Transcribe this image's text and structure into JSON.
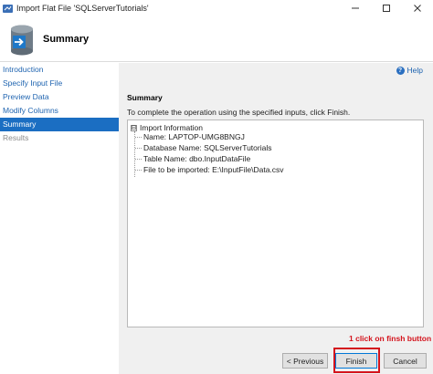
{
  "window": {
    "title": "Import Flat File 'SQLServerTutorials'",
    "controls": [
      "minimize-icon",
      "maximize-icon",
      "close-icon"
    ]
  },
  "header": {
    "title": "Summary",
    "icon": "database-import-icon"
  },
  "nav": {
    "items": [
      {
        "label": "Introduction",
        "state": "link"
      },
      {
        "label": "Specify Input File",
        "state": "link"
      },
      {
        "label": "Preview Data",
        "state": "link"
      },
      {
        "label": "Modify Columns",
        "state": "link"
      },
      {
        "label": "Summary",
        "state": "active"
      },
      {
        "label": "Results",
        "state": "disabled"
      }
    ]
  },
  "content": {
    "help_label": "Help",
    "section_title": "Summary",
    "instruction": "To complete the operation using the specified inputs, click Finish.",
    "tree": {
      "root_label": "Import Information",
      "expander": "⊟",
      "children": [
        "Name: LAPTOP-UMG8BNGJ",
        "Database Name: SQLServerTutorials",
        "Table Name: dbo.InputDataFile",
        "File to be imported: E:\\InputFile\\Data.csv"
      ]
    },
    "annotation": "1 click on finsh button"
  },
  "footer": {
    "previous_label": "< Previous",
    "finish_label": "Finish",
    "cancel_label": "Cancel"
  },
  "colors": {
    "link": "#1f64b0",
    "active_bg": "#1b6ec2",
    "annotation": "#d4141d",
    "content_bg": "#f0f0f0"
  }
}
